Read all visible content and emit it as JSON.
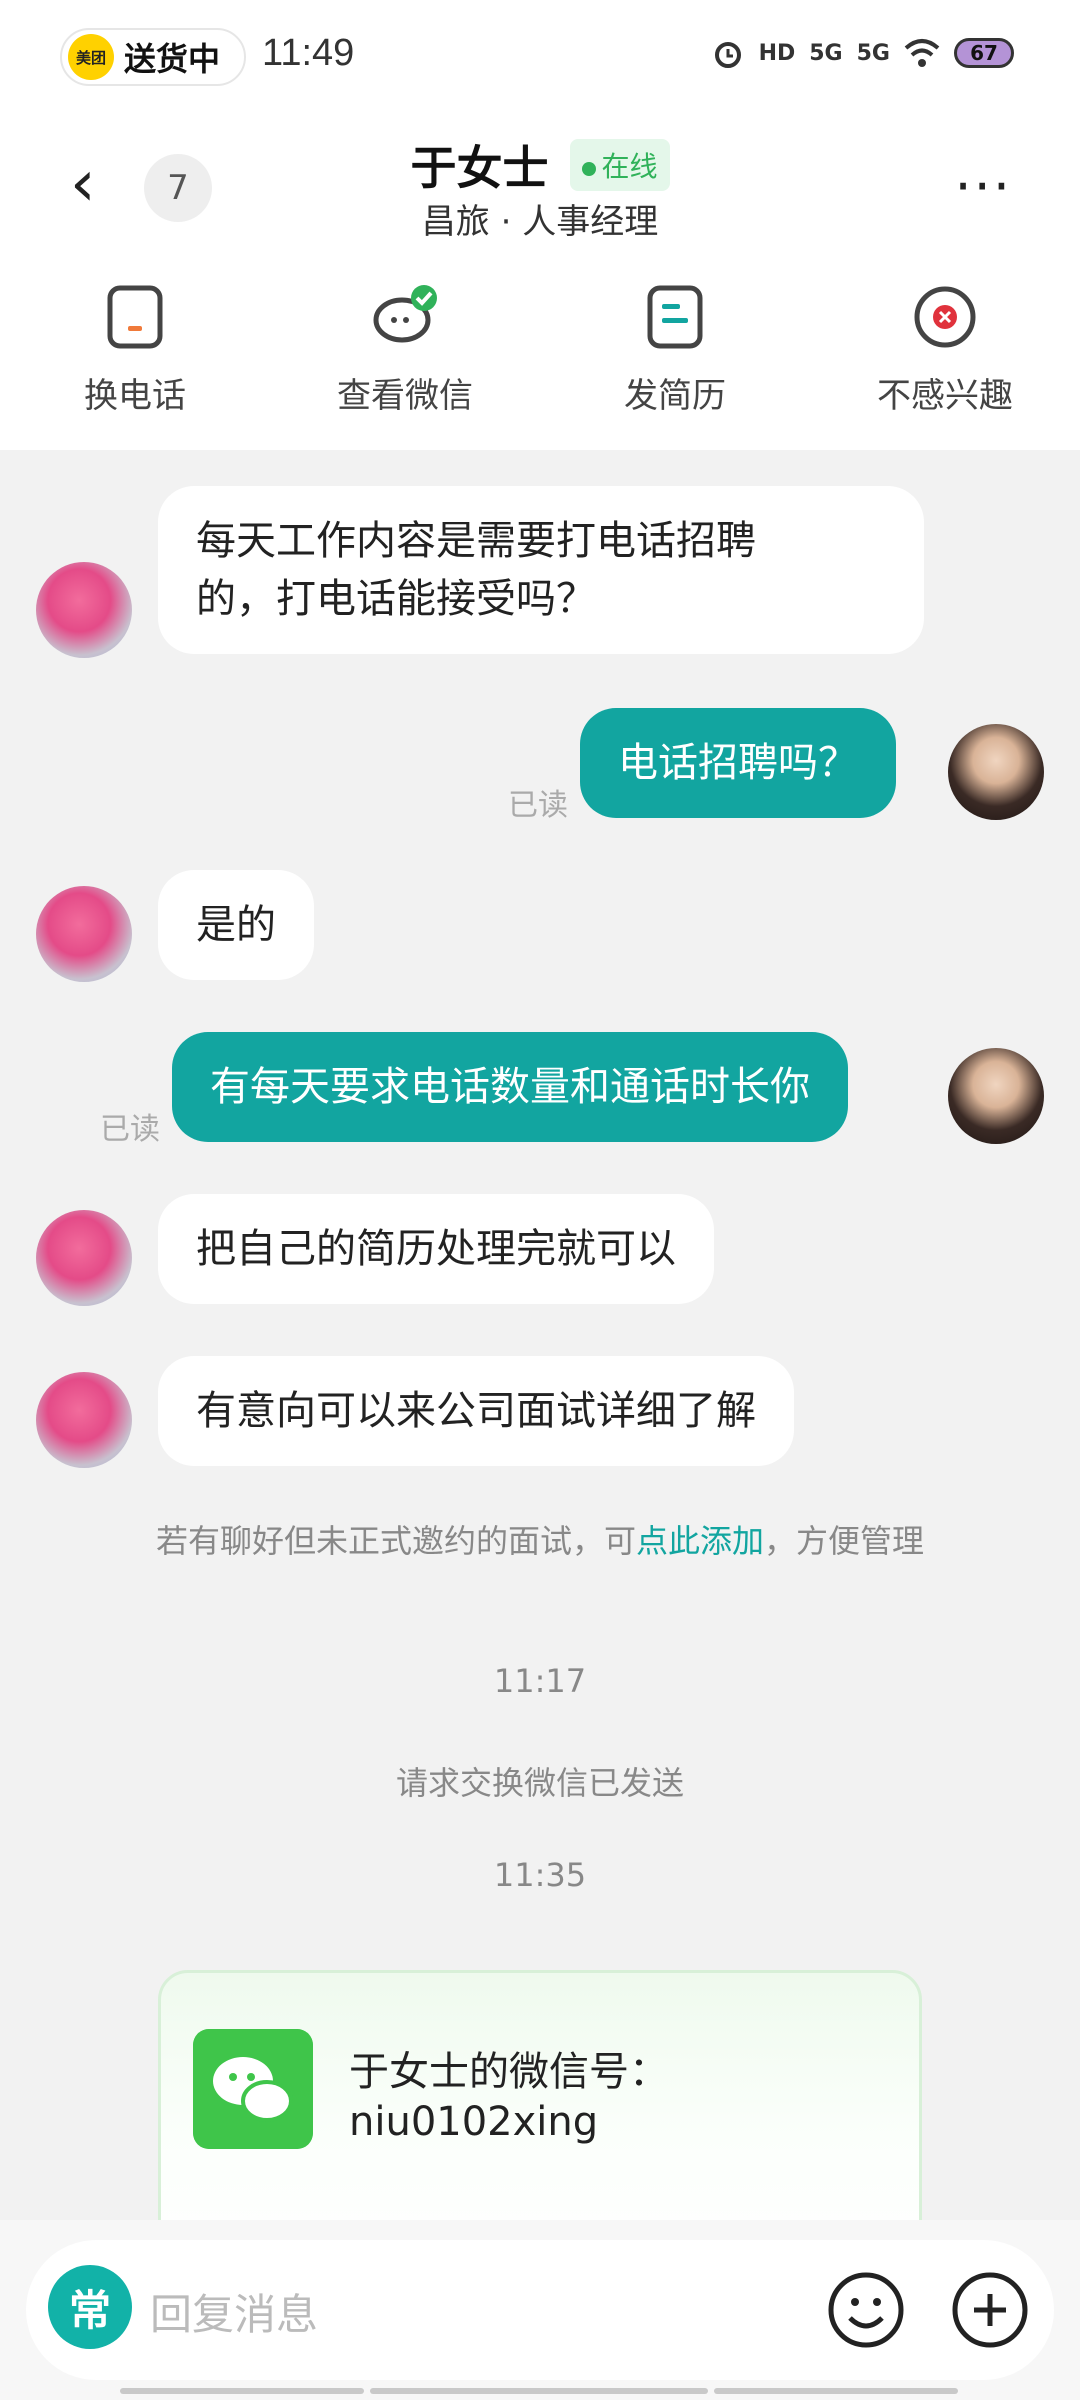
{
  "status_bar": {
    "app_badge_logo": "美团",
    "app_badge_text": "送货中",
    "time": "11:49",
    "battery": "67",
    "network_1": "5G",
    "network_2": "5G",
    "hd_label": "HD"
  },
  "header": {
    "unread_count": "7",
    "name": "于女士",
    "online": "在线",
    "subtitle": "昌旅 · 人事经理",
    "actions": [
      {
        "label": "换电话",
        "icon": "phone-swap-icon"
      },
      {
        "label": "查看微信",
        "icon": "wechat-view-icon"
      },
      {
        "label": "发简历",
        "icon": "resume-icon"
      },
      {
        "label": "不感兴趣",
        "icon": "not-interested-icon"
      }
    ]
  },
  "messages": [
    {
      "from": "recruiter",
      "text_line1": "每天工作内容是需要打电话招聘",
      "text_line2": "的，打电话能接受吗？"
    },
    {
      "from": "me",
      "text": "电话招聘吗？",
      "status": "已读"
    },
    {
      "from": "recruiter",
      "text": "是的"
    },
    {
      "from": "me",
      "text": "有每天要求电话数量和通话时长你",
      "status": "已读"
    },
    {
      "from": "recruiter",
      "text": "把自己的简历处理完就可以"
    },
    {
      "from": "recruiter",
      "text": "有意向可以来公司面试详细了解"
    }
  ],
  "system": {
    "note_before": "若有聊好但未正式邀约的面试，可",
    "note_link": "点此添加",
    "note_after": "，方便管理",
    "time1": "11:17",
    "wechat_request": "请求交换微信已发送",
    "time2": "11:35"
  },
  "wechat_card": {
    "line1": "于女士的微信号：",
    "line2": "niu0102xing"
  },
  "input": {
    "common_label": "常",
    "placeholder": "回复消息"
  },
  "colors": {
    "accent": "#12a5a0",
    "online": "#30b25a",
    "wechat": "#3fc54a",
    "danger": "#e0323c"
  }
}
